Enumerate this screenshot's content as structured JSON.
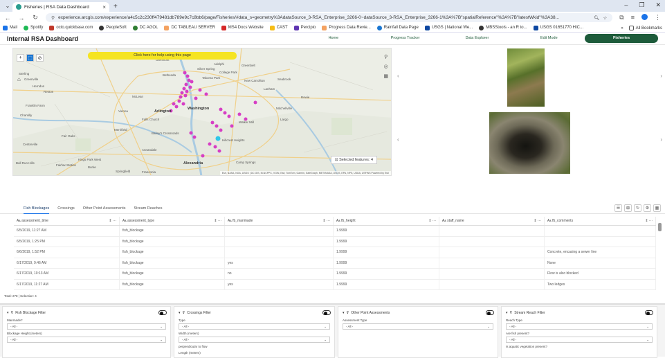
{
  "browser": {
    "tab_title": "Fisheries | RSA Data Dashboard",
    "url": "experience.arcgis.com/experience/a4c5c2c230ff479481db789e9c7c8bb6/page/Fisheries/#data_s=geometry%3AdataSource_3-RSA_Enterprise_3266-0~dataSource_3-RSA_Enterprise_3266-1%3A%7B\"spatialReference\"%3A%7B\"latestWkid\"%3A38...",
    "bookmarks": [
      "Mail",
      "Spotify",
      "octo.quickbase.com",
      "PeopleSoft",
      "DC AGOL",
      "DC TABLEAU SERVER",
      "MS4 Docs Website",
      "CAST",
      "Percipio",
      "Progress Data Revie...",
      "Rainfall Data Page",
      "USGS | National We...",
      "MBSStools - an R to...",
      "USGS 01651770 HIC..."
    ],
    "all_bookmarks": "All Bookmarks"
  },
  "app": {
    "title": "Internal RSA Dashboard",
    "nav": [
      "Home",
      "Progress Tracker",
      "Data Explorer",
      "Edit Mode",
      "Fisheries"
    ],
    "active_nav": "Fisheries"
  },
  "map": {
    "help_text": "Click here for help using this page",
    "selected_features": "Selected features: 4",
    "attribution": "Esri, NASA, NGA, USGS | DC GIS, M-NCPPC, VGIN, Esri, TomTom, Garmin, SafeGraph, METI/NASA, USGS, EPA, NPS, USDA, USFWS   Powered by Esri",
    "labels": [
      "Sterling",
      "Greenville",
      "Herndon",
      "Reston",
      "Franklin Farm",
      "Chantilly",
      "Fair Oaks",
      "Centreville",
      "Bull Run Hills",
      "Burke",
      "Fairfax Station",
      "Kings Park West",
      "Springfield",
      "Franconia",
      "Annandale",
      "Merrifield",
      "Vienna",
      "McLean",
      "Bethesda",
      "Silver Spring",
      "Takoma Park",
      "College Park",
      "Arlington",
      "Washington",
      "Alexandria",
      "Camp Springs",
      "Hillcrest Heights",
      "Walker Mill",
      "Bowie",
      "Mitchellville",
      "Largo",
      "Glenmont",
      "Beltsville",
      "Adelphi",
      "Greenbelt",
      "Bailey's Crossroads",
      "Falls Church",
      "Seabrook",
      "Lanham",
      "New Carrollton"
    ]
  },
  "data_tabs": [
    "Fish Blockages",
    "Crossings",
    "Other Point Assessments",
    "Stream Reaches"
  ],
  "active_data_tab": "Fish Blockages",
  "table": {
    "columns": [
      "assessment_time",
      "assessment_type",
      "fb_manmade",
      "fb_height",
      "staff_name",
      "fb_comments"
    ],
    "rows": [
      [
        "6/5/2019, 11:27 AM",
        "fish_blockage",
        "",
        "1.9999",
        "",
        ""
      ],
      [
        "6/5/2019, 1:25 PM",
        "fish_blockage",
        "",
        "1.9999",
        "",
        ""
      ],
      [
        "6/6/2019, 1:52 PM",
        "fish_blockage",
        "",
        "1.9999",
        "",
        "Concrete, encasing a sewer line"
      ],
      [
        "6/17/2019, 9:46 AM",
        "fish_blockage",
        "yes",
        "1.9999",
        "",
        "None"
      ],
      [
        "6/17/2019, 10:13 AM",
        "fish_blockage",
        "no",
        "1.9999",
        "",
        "Flow is also blocked"
      ],
      [
        "6/17/2019, 11:27 AM",
        "fish_blockage",
        "yes",
        "1.9999",
        "",
        "Two ledges"
      ]
    ],
    "total": "Total: 278 | Selection: 4"
  },
  "filters": [
    {
      "title": "Fish Blockage Filter",
      "fields": [
        {
          "label": "Manmade?",
          "value": "- All -"
        },
        {
          "label": "Blockage Height (meters)",
          "value": "- All -"
        }
      ]
    },
    {
      "title": "Crossings Filter",
      "fields": [
        {
          "label": "Type",
          "value": "- All -"
        },
        {
          "label": "Width (meters)",
          "value": "- All -"
        }
      ],
      "extra": [
        "perpendicular to flow",
        "Length (meters)"
      ]
    },
    {
      "title": "Other Point Assessments",
      "fields": [
        {
          "label": "Assessment Type",
          "value": "- All -"
        }
      ]
    },
    {
      "title": "Stream Reach Filter",
      "fields": [
        {
          "label": "Reach Type",
          "value": "- All -"
        },
        {
          "label": "Are fish present?",
          "value": "- All -"
        }
      ],
      "extra": [
        "Is aquatic vegetation present?"
      ]
    }
  ]
}
